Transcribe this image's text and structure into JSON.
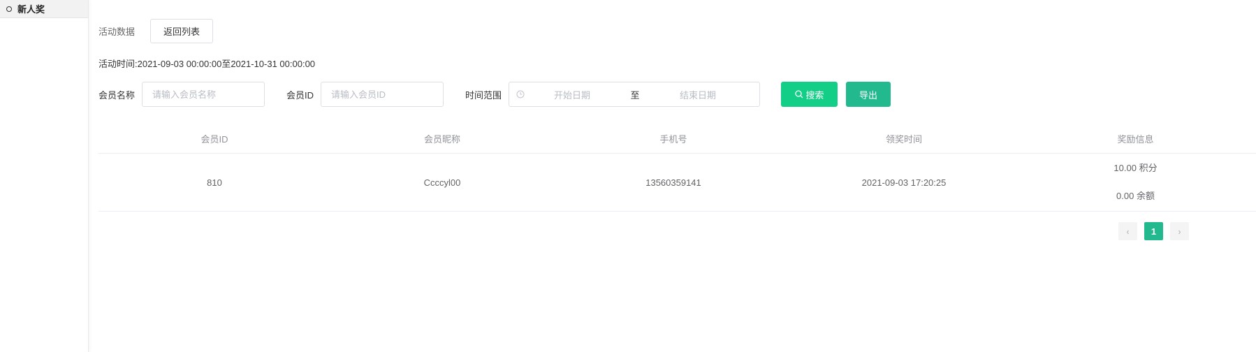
{
  "sidebar": {
    "items": [
      {
        "label": "新人奖"
      }
    ]
  },
  "header": {
    "section_label": "活动数据",
    "back_button": "返回列表",
    "activity_time": "活动时间:2021-09-03 00:00:00至2021-10-31 00:00:00"
  },
  "filters": {
    "member_name_label": "会员名称",
    "member_name_placeholder": "请输入会员名称",
    "member_id_label": "会员ID",
    "member_id_placeholder": "请输入会员ID",
    "time_range_label": "时间范围",
    "start_placeholder": "开始日期",
    "range_separator": "至",
    "end_placeholder": "结束日期",
    "search_button": "搜索",
    "export_button": "导出"
  },
  "table": {
    "columns": [
      "会员ID",
      "会员昵称",
      "手机号",
      "领奖时间",
      "奖励信息"
    ],
    "rows": [
      {
        "member_id": "810",
        "nickname": "Ccccyl00",
        "phone": "13560359141",
        "award_time": "2021-09-03 17:20:25",
        "reward_points": "10.00 积分",
        "reward_balance": "0.00 余额"
      }
    ]
  },
  "pagination": {
    "prev": "‹",
    "current": "1",
    "next": "›"
  },
  "colors": {
    "search_btn": "#13ce86",
    "export_btn": "#23b98e",
    "active_page": "#23b98e"
  }
}
